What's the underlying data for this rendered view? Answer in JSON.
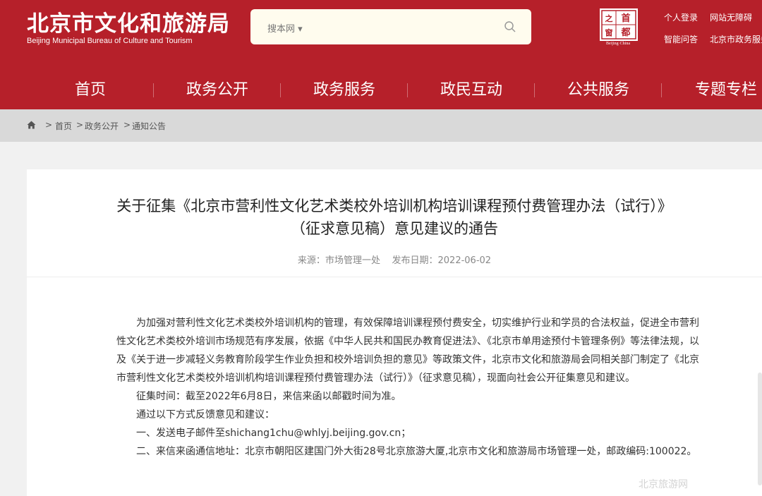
{
  "header": {
    "logo_cn": "北京市文化和旅游局",
    "logo_en": "Beijing Municipal Bureau of Culture and Tourism",
    "search_scope": "搜本网 ▾",
    "search_placeholder": "",
    "emblem_chars": [
      "首",
      "之",
      "都",
      "窗"
    ],
    "emblem_sub": "Beijing·China",
    "links": [
      "个人登录",
      "网站无障碍",
      "智能问答",
      "北京市政务服务"
    ]
  },
  "nav": {
    "items": [
      "首页",
      "政务公开",
      "政务服务",
      "政民互动",
      "公共服务",
      "专题专栏"
    ]
  },
  "breadcrumb": {
    "items": [
      "首页",
      "政务公开",
      "通知公告"
    ],
    "separator": ">"
  },
  "article": {
    "title_line1": "关于征集《北京市营利性文化艺术类校外培训机构培训课程预付费管理办法（试行）》",
    "title_line2": "（征求意见稿）意见建议的通告",
    "source_label": "来源：",
    "source": "市场管理一处",
    "date_label": "发布日期：",
    "date": "2022-06-02",
    "paragraphs": [
      "为加强对营利性文化艺术类校外培训机构的管理，有效保障培训课程预付费安全，切实维护行业和学员的合法权益，促进全市营利性文化艺术类校外培训市场规范有序发展，依据《中华人民共和国民办教育促进法》、《北京市单用途预付卡管理条例》等法律法规，以及《关于进一步减轻义务教育阶段学生作业负担和校外培训负担的意见》等政策文件，北京市文化和旅游局会同相关部门制定了《北京市营利性文化艺术类校外培训机构培训课程预付费管理办法（试行）》（征求意见稿），现面向社会公开征集意见和建议。",
      "征集时间：截至2022年6月8日，来信来函以邮戳时间为准。",
      "通过以下方式反馈意见和建议：",
      "一、发送电子邮件至shichang1chu@whlyj.beijing.gov.cn；",
      "二、来信来函通信地址：北京市朝阳区建国门外大街28号北京旅游大厦,北京市文化和旅游局市场管理一处，邮政编码:100022。"
    ]
  },
  "watermark": "北京旅游网",
  "colors": {
    "brand_red": "#b6202a",
    "breadcrumb_bg": "#d9d9d9",
    "search_bg": "#fffcee"
  }
}
